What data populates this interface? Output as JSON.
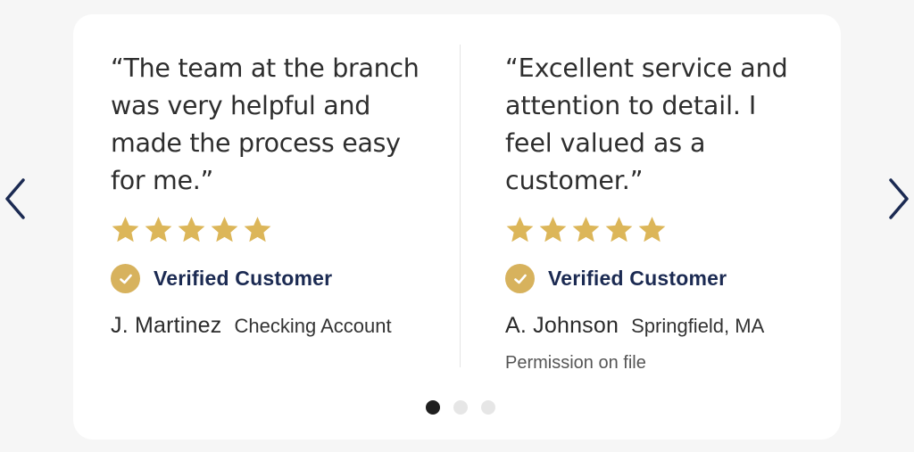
{
  "carousel": {
    "prev_icon": "chevron-left-icon",
    "next_icon": "chevron-right-icon",
    "page_count": 3,
    "active_page": 1
  },
  "reviews": [
    {
      "quote": "“The team at the branch was very helpful and made the process easy for me.”",
      "rating": 5,
      "verified_label": "Verified Customer",
      "author": "J. Martinez",
      "detail": "Checking Account"
    },
    {
      "quote": "“Excellent service and attention to detail. I feel valued as a customer.”",
      "rating": 5,
      "verified_label": "Verified Customer",
      "author": "A. Johnson",
      "detail": "Springfield, MA",
      "note": "Permission on file"
    }
  ],
  "colors": {
    "star": "#dcb659",
    "badge": "#d7b25d",
    "brand_navy": "#1b2a52",
    "arrow": "#1b2a52"
  }
}
